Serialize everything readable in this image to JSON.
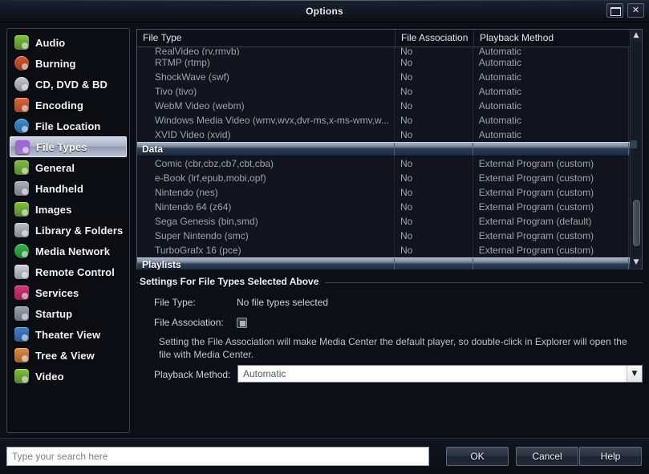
{
  "window": {
    "title": "Options",
    "controls": {
      "restore": "restore-window",
      "close": "✕"
    }
  },
  "sidebar": {
    "items": [
      {
        "label": "Audio",
        "icon": "audio-icon",
        "color": "#7ec13c",
        "selected": false
      },
      {
        "label": "Burning",
        "icon": "burning-disc-icon",
        "color": "#d4562a",
        "selected": false,
        "shape": "circ"
      },
      {
        "label": "CD, DVD & BD",
        "icon": "optical-disc-icon",
        "color": "#c7cdd6",
        "selected": false,
        "shape": "circ"
      },
      {
        "label": "Encoding",
        "icon": "encoding-icon",
        "color": "#e0643a",
        "selected": false
      },
      {
        "label": "File Location",
        "icon": "compass-icon",
        "color": "#3b8fd6",
        "selected": false,
        "shape": "circ"
      },
      {
        "label": "File Types",
        "icon": "puzzle-piece-icon",
        "color": "#9a5fd0",
        "selected": true
      },
      {
        "label": "General",
        "icon": "checkbox-green-icon",
        "color": "#7ec13c",
        "selected": false
      },
      {
        "label": "Handheld",
        "icon": "handheld-device-icon",
        "color": "#aab2be",
        "selected": false
      },
      {
        "label": "Images",
        "icon": "images-icon",
        "color": "#7ec13c",
        "selected": false
      },
      {
        "label": "Library & Folders",
        "icon": "folder-play-icon",
        "color": "#b9c2cf",
        "selected": false
      },
      {
        "label": "Media Network",
        "icon": "network-sync-icon",
        "color": "#35b64a",
        "selected": false,
        "shape": "circ"
      },
      {
        "label": "Remote Control",
        "icon": "remote-control-icon",
        "color": "#cfd5df",
        "selected": false
      },
      {
        "label": "Services",
        "icon": "services-gear-icon",
        "color": "#d8327a",
        "selected": false
      },
      {
        "label": "Startup",
        "icon": "startup-icon",
        "color": "#9aa3b2",
        "selected": false
      },
      {
        "label": "Theater View",
        "icon": "monitor-icon",
        "color": "#3f7fd0",
        "selected": false
      },
      {
        "label": "Tree & View",
        "icon": "tree-view-icon",
        "color": "#e08a45",
        "selected": false
      },
      {
        "label": "Video",
        "icon": "video-icon",
        "color": "#7ec13c",
        "selected": false
      }
    ]
  },
  "filetypes_table": {
    "columns": [
      "File Type",
      "File Association",
      "Playback Method"
    ],
    "rows": [
      {
        "kind": "item",
        "clipped": true,
        "filetype": "RealVideo (rv,rmvb)",
        "association": "No",
        "playback": "Automatic"
      },
      {
        "kind": "item",
        "filetype": "RTMP (rtmp)",
        "association": "No",
        "playback": "Automatic"
      },
      {
        "kind": "item",
        "filetype": "ShockWave (swf)",
        "association": "No",
        "playback": "Automatic"
      },
      {
        "kind": "item",
        "filetype": "Tivo (tivo)",
        "association": "No",
        "playback": "Automatic"
      },
      {
        "kind": "item",
        "filetype": "WebM Video (webm)",
        "association": "No",
        "playback": "Automatic"
      },
      {
        "kind": "item",
        "filetype": "Windows Media Video (wmv,wvx,dvr-ms,x-ms-wmv,w...",
        "association": "No",
        "playback": "Automatic"
      },
      {
        "kind": "item",
        "filetype": "XVID Video (xvid)",
        "association": "No",
        "playback": "Automatic"
      },
      {
        "kind": "group",
        "filetype": "Data"
      },
      {
        "kind": "item",
        "filetype": "Comic (cbr,cbz,cb7,cbt,cba)",
        "association": "No",
        "playback": "External Program (custom)"
      },
      {
        "kind": "item",
        "filetype": "e-Book (lrf,epub,mobi,opf)",
        "association": "No",
        "playback": "External Program (custom)"
      },
      {
        "kind": "item",
        "filetype": "Nintendo (nes)",
        "association": "No",
        "playback": "External Program (custom)"
      },
      {
        "kind": "item",
        "filetype": "Nintendo 64 (z64)",
        "association": "No",
        "playback": "External Program (custom)"
      },
      {
        "kind": "item",
        "filetype": "Sega Genesis (bin,smd)",
        "association": "No",
        "playback": "External Program (default)"
      },
      {
        "kind": "item",
        "filetype": "Super Nintendo (smc)",
        "association": "No",
        "playback": "External Program (custom)"
      },
      {
        "kind": "item",
        "filetype": "TurboGrafx 16 (pce)",
        "association": "No",
        "playback": "External Program (custom)"
      },
      {
        "kind": "group",
        "filetype": "Playlists"
      }
    ],
    "scroll_up": "▲",
    "scroll_down": "▼"
  },
  "settings": {
    "group_title": "Settings For File Types Selected Above",
    "file_type_label": "File Type:",
    "file_type_value": "No file types selected",
    "file_association_label": "File Association:",
    "file_association_state": "indeterminate",
    "hint": "Setting the File Association will make Media Center the default player, so double-click in Explorer will open the file with Media Center.",
    "playback_method_label": "Playback Method:",
    "playback_method_value": "Automatic",
    "dropdown_arrow": "▼"
  },
  "footer": {
    "search_placeholder": "Type your search here",
    "search_value": "",
    "ok_label": "OK",
    "cancel_label": "Cancel",
    "help_label": "Help"
  }
}
